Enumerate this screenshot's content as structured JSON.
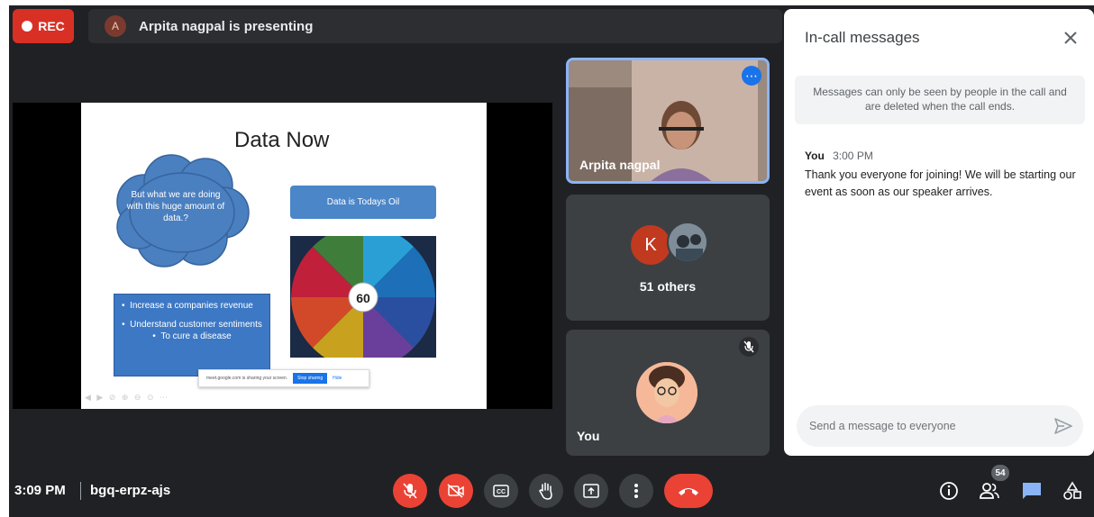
{
  "top_bar": {
    "rec_label": "REC",
    "presenter_initial": "A",
    "presenting_text": "Arpita nagpal is presenting"
  },
  "slide": {
    "title": "Data Now",
    "cloud_text": "But what we are doing with this huge amount of data.?",
    "oil_box": "Data is Todays Oil",
    "wheel_label": "60",
    "bullets": [
      "Increase a companies revenue",
      "Understand customer sentiments",
      "To cure a disease"
    ],
    "share_text": "meet.google.com is sharing your screen.",
    "share_stop": "Stop sharing",
    "share_hide": "Hide"
  },
  "tiles": {
    "arpita_name": "Arpita nagpal",
    "others_initial": "K",
    "others_label": "51 others",
    "you_label": "You"
  },
  "chat": {
    "title": "In-call messages",
    "notice": "Messages can only be seen by people in the call and are deleted when the call ends.",
    "messages": [
      {
        "sender": "You",
        "time": "3:00 PM",
        "text": "Thank you everyone for joining! We will be starting our event as soon as our speaker arrives."
      }
    ],
    "input_placeholder": "Send a message to everyone"
  },
  "bottom_bar": {
    "time": "3:09 PM",
    "meeting_code": "bgq-erpz-ajs",
    "participants_count": "54"
  },
  "colors": {
    "danger": "#ea4335",
    "accent": "#1a73e8",
    "stage_bg": "#202124",
    "tile_bg": "#3c4043"
  }
}
